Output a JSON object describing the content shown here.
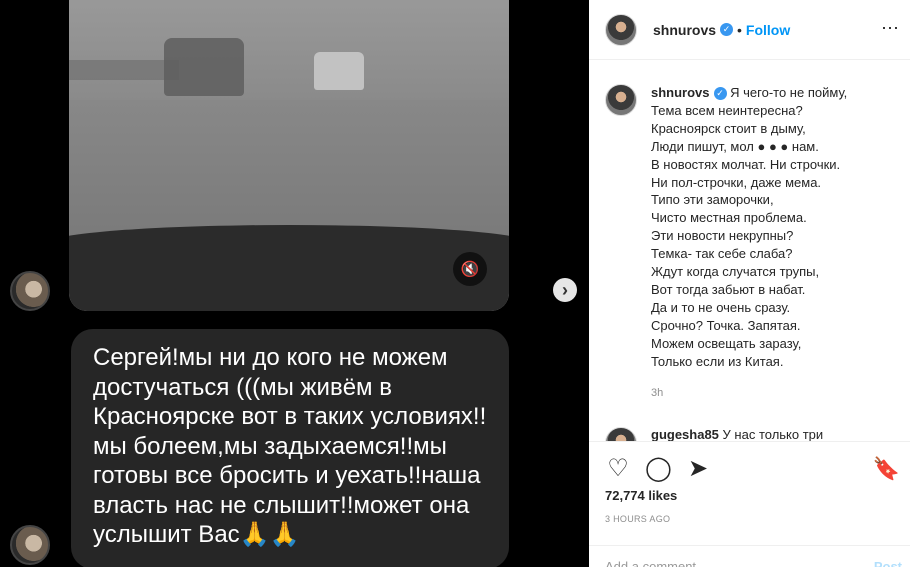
{
  "post": {
    "username": "shnurovs",
    "dot": "•",
    "follow_label": "Follow",
    "more_icon": "ellipsis-icon",
    "caption_lines": "Я чего-то не пойму,\nТема всем неинтересна?\nКрасноярск стоит в дыму,\nЛюди пишут, мол ● ● ● нам.\nВ новостях молчат. Ни строчки.\nНи пол-строчки, даже мема.\nТипо эти заморочки,\nЧисто местная проблема.\nЭти новости некрупны?\nТемка- так себе слаба?\nЖдут когда случатся трупы,\nВот тогда забьют в набат.\nДа и то не очень сразу.\nСрочно? Точка. Запятая.\nМожем освещать заразу,\nТолько если из Китая.",
    "caption_time": "3h",
    "comment2_user": "gugesha85",
    "comment2_text": "У нас только три",
    "likes": "72,774 likes",
    "ago": "3 HOURS AGO",
    "add_comment_placeholder": "Add a comment...",
    "post_label": "Post"
  },
  "media": {
    "bubble_text": "Сергей!мы ни до кого не можем\nдостучаться (((мы живём в\nКрасноярске вот в таких условиях!!\nмы болеем,мы задыхаемся!!мы\nготовы все бросить и уехать!!наша\nвласть нас не слышит!!может она\nуслышит Вас🙏🙏"
  },
  "icons": {
    "verified": "verified-badge-icon",
    "mute": "mute-icon",
    "next": "chevron-right-icon",
    "like": "heart-icon",
    "comment": "comment-icon",
    "share": "share-icon",
    "save": "bookmark-icon"
  },
  "colors": {
    "follow_accent": "#0095f6",
    "verified": "#3897f0",
    "media_bg": "#000000"
  }
}
